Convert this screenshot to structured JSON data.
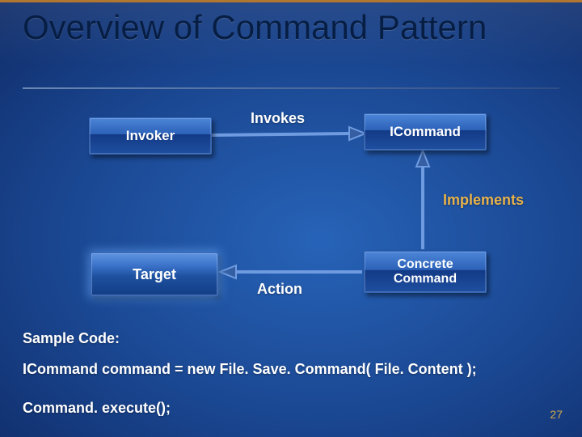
{
  "title": "Overview of Command Pattern",
  "nodes": {
    "invoker": "Invoker",
    "icommand": "ICommand",
    "target": "Target",
    "concrete": "Concrete Command"
  },
  "edges": {
    "invokes": "Invokes",
    "implements": "Implements",
    "action": "Action"
  },
  "footer": {
    "sample_heading": "Sample Code:",
    "code_line": "ICommand command = new File. Save. Command( File. Content );",
    "exec_line": "Command. execute();"
  },
  "slide_number": "27",
  "chart_data": {
    "type": "diagram",
    "title": "Overview of Command Pattern",
    "nodes": [
      {
        "id": "invoker",
        "label": "Invoker"
      },
      {
        "id": "icommand",
        "label": "ICommand"
      },
      {
        "id": "concrete",
        "label": "Concrete Command"
      },
      {
        "id": "target",
        "label": "Target"
      }
    ],
    "edges": [
      {
        "from": "invoker",
        "to": "icommand",
        "label": "Invokes"
      },
      {
        "from": "concrete",
        "to": "icommand",
        "label": "Implements"
      },
      {
        "from": "concrete",
        "to": "target",
        "label": "Action"
      }
    ]
  }
}
